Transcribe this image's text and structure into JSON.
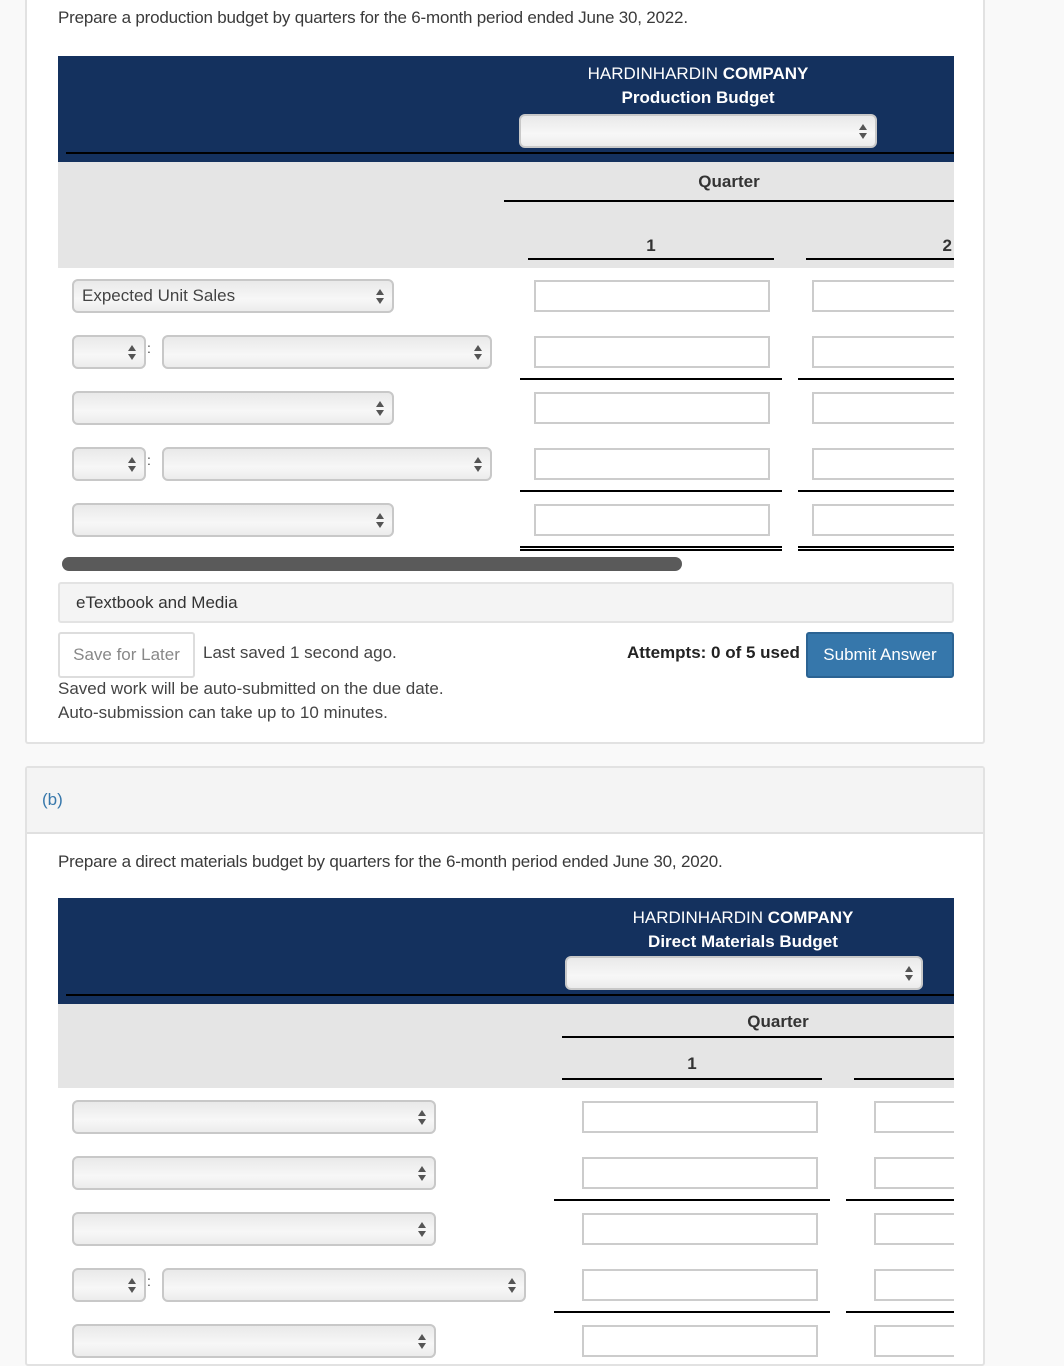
{
  "part_a": {
    "prompt": "Prepare a production budget by quarters for the 6-month period ended June 30, 2022.",
    "company_prefix": "HARDINHARDIN ",
    "company_suffix": "COMPANY",
    "budget_title": "Production Budget",
    "period_select": "",
    "column_group": "Quarter",
    "columns": [
      "1",
      "2"
    ],
    "rows": [
      {
        "type": "select",
        "label": "Expected Unit Sales",
        "values": [
          "",
          ""
        ]
      },
      {
        "type": "prefix-select",
        "prefix": "",
        "label": "",
        "values": [
          "",
          ""
        ]
      },
      {
        "type": "select",
        "label": "",
        "values": [
          "",
          ""
        ]
      },
      {
        "type": "prefix-select",
        "prefix": "",
        "label": "",
        "values": [
          "",
          ""
        ]
      },
      {
        "type": "select",
        "label": "",
        "values": [
          "",
          ""
        ]
      }
    ],
    "etextbook_label": "eTextbook and Media",
    "save_label": "Save for Later",
    "last_saved": "Last saved 1 second ago.",
    "note_line1": "Saved work will be auto-submitted on the due date.",
    "note_line2": "Auto-submission can take up to 10 minutes.",
    "attempts": "Attempts: 0 of 5 used",
    "submit_label": "Submit Answer"
  },
  "part_b": {
    "label": "(b)",
    "prompt": "Prepare a direct materials budget by quarters for the 6-month period ended June 30, 2020.",
    "company_prefix": "HARDINHARDIN ",
    "company_suffix": "COMPANY",
    "budget_title": "Direct Materials Budget",
    "period_select": "",
    "column_group": "Quarter",
    "columns": [
      "1",
      ""
    ],
    "rows": [
      {
        "type": "select",
        "label": "",
        "values": [
          "",
          ""
        ]
      },
      {
        "type": "select",
        "label": "",
        "values": [
          "",
          ""
        ]
      },
      {
        "type": "select",
        "label": "",
        "values": [
          "",
          ""
        ]
      },
      {
        "type": "prefix-select",
        "prefix": "",
        "label": "",
        "values": [
          "",
          ""
        ]
      },
      {
        "type": "select",
        "label": "",
        "values": [
          "",
          ""
        ]
      }
    ]
  },
  "colors": {
    "header_navy": "#14315e",
    "submit_blue": "#3677ab",
    "part_label_blue": "#3677ab"
  }
}
